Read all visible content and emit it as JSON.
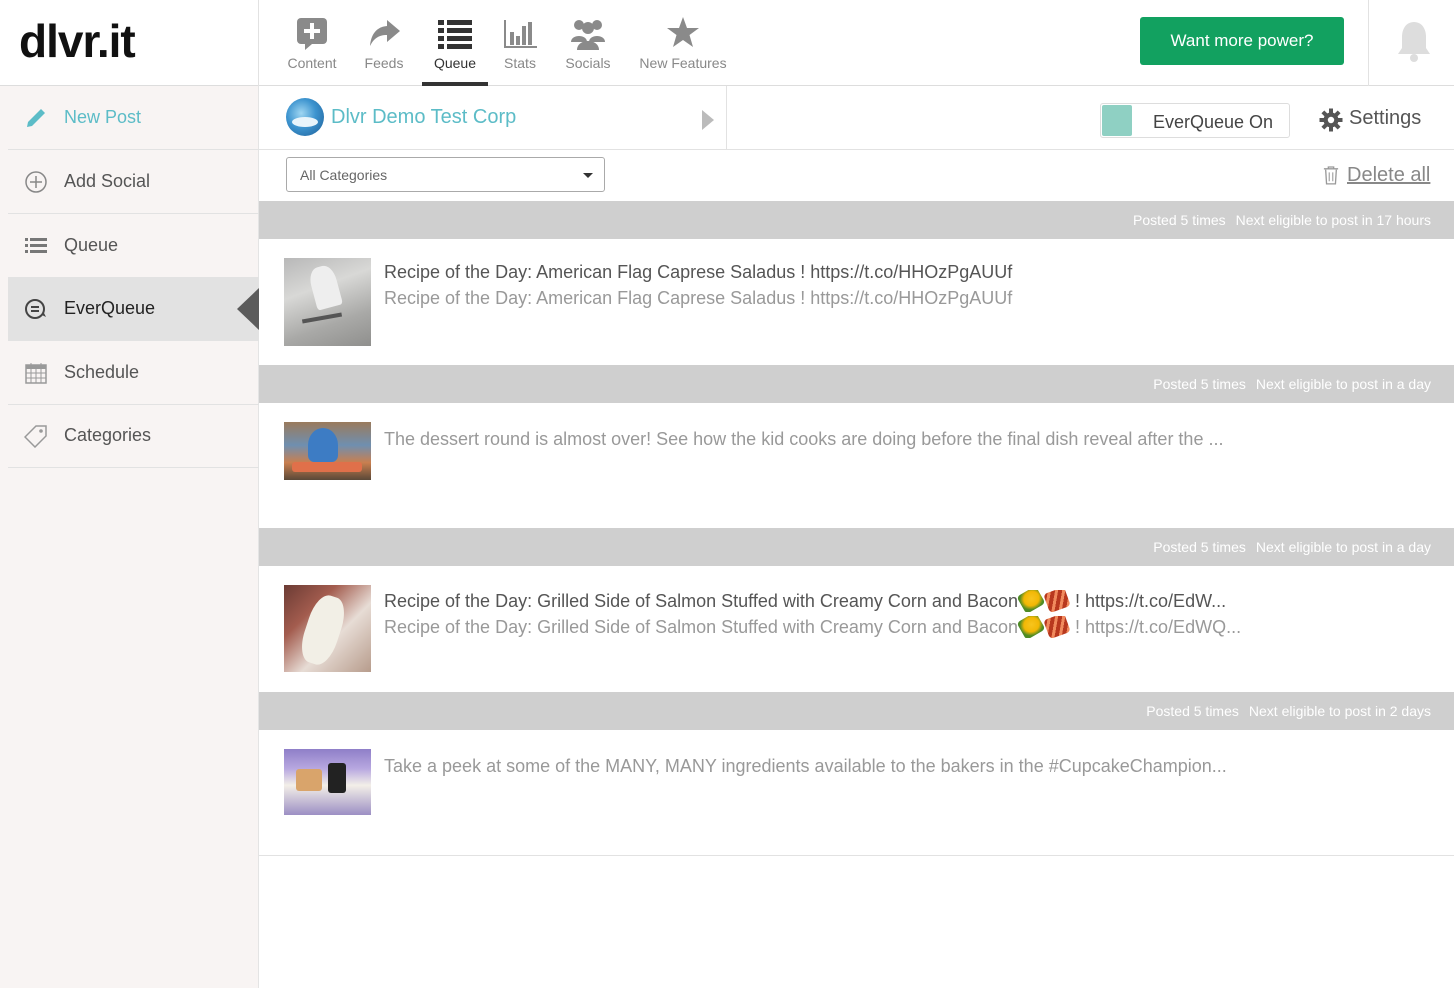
{
  "brand": {
    "logo": "dlvr.it"
  },
  "nav": [
    {
      "label": "Content",
      "icon": "content-plus-icon"
    },
    {
      "label": "Feeds",
      "icon": "share-arrow-icon"
    },
    {
      "label": "Queue",
      "icon": "list-icon",
      "active": true
    },
    {
      "label": "Stats",
      "icon": "bar-chart-icon"
    },
    {
      "label": "Socials",
      "icon": "users-icon"
    },
    {
      "label": "New Features",
      "icon": "star-icon"
    }
  ],
  "cta": {
    "label": "Want more power?"
  },
  "sidebar": {
    "items": [
      {
        "label": "New Post",
        "icon": "pencil-icon"
      },
      {
        "label": "Add Social",
        "icon": "plus-circle-icon"
      },
      {
        "label": "Queue",
        "icon": "list-icon"
      },
      {
        "label": "EverQueue",
        "icon": "everqueue-icon",
        "active": true
      },
      {
        "label": "Schedule",
        "icon": "calendar-icon"
      },
      {
        "label": "Categories",
        "icon": "tag-icon"
      }
    ]
  },
  "account": {
    "name": "Dlvr Demo Test Corp"
  },
  "everqueue_toggle": {
    "label": "EverQueue On",
    "on": true
  },
  "settings": {
    "label": "Settings"
  },
  "filter": {
    "selected": "All Categories"
  },
  "delete_all": {
    "label": "Delete all"
  },
  "queue": [
    {
      "posted": "Posted 5 times",
      "next": "Next eligible to post in 17 hours",
      "title": "Recipe of the Day: American Flag Caprese Saladus ! https://t.co/HHOzPgAUUf",
      "subtitle": "Recipe of the Day: American Flag Caprese Saladus ! https://t.co/HHOzPgAUUf"
    },
    {
      "posted": "Posted 5 times",
      "next": "Next eligible to post in a day",
      "title": "The dessert round is almost over! See how the kid cooks are doing before the final dish reveal after the ..."
    },
    {
      "posted": "Posted 5 times",
      "next": "Next eligible to post in a day",
      "title_a": "Recipe of the Day: Grilled Side of Salmon Stuffed with Creamy Corn and Bacon",
      "title_b": "! https://t.co/EdW...",
      "subtitle_a": "Recipe of the Day: Grilled Side of Salmon Stuffed with Creamy Corn and Bacon",
      "subtitle_b": "! https://t.co/EdWQ...",
      "emojis": [
        "corn-emoji",
        "bacon-emoji"
      ]
    },
    {
      "posted": "Posted 5 times",
      "next": "Next eligible to post in 2 days",
      "title": "Take a peek at some of the MANY, MANY ingredients available to the bakers in the #CupcakeChampion..."
    }
  ],
  "colors": {
    "accent": "#5cbcc7",
    "cta": "#12a160",
    "header_bar": "#cfcfcf",
    "toggle": "#8fd0c3"
  }
}
